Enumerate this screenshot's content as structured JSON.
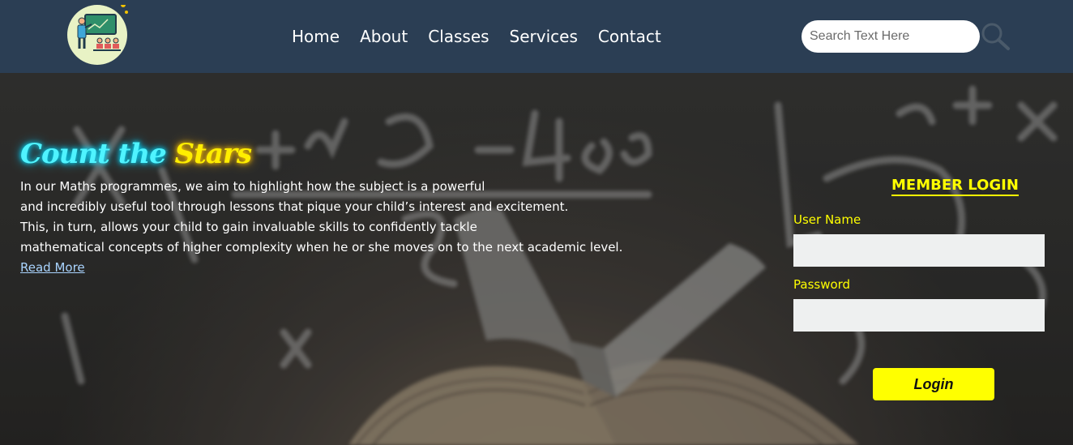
{
  "header": {
    "nav": [
      "Home",
      "About",
      "Classes",
      "Services",
      "Contact"
    ],
    "search_placeholder": "Search Text Here",
    "colors": {
      "background": "#2b3e54"
    }
  },
  "hero": {
    "brand_part1": "Count the",
    "brand_part2": "Stars",
    "paragraph_lines": [
      "In our Maths programmes, we aim to highlight how the subject is a powerful",
      "and incredibly useful tool through lessons that pique your child’s interest and excitement.",
      "This, in turn, allows your child to gain invaluable skills to confidently tackle",
      "mathematical concepts of higher complexity when he or she moves on to the next academic level."
    ],
    "read_more": "Read More",
    "colors": {
      "brand_cyan": "#4ff3ff",
      "brand_yellow": "#ffee00",
      "link": "#a9d4ff"
    }
  },
  "login": {
    "title": "MEMBER LOGIN",
    "username_label": "User Name",
    "password_label": "Password",
    "button": "Login",
    "colors": {
      "accent": "#ffff00",
      "field_bg": "#eef0f0"
    }
  }
}
